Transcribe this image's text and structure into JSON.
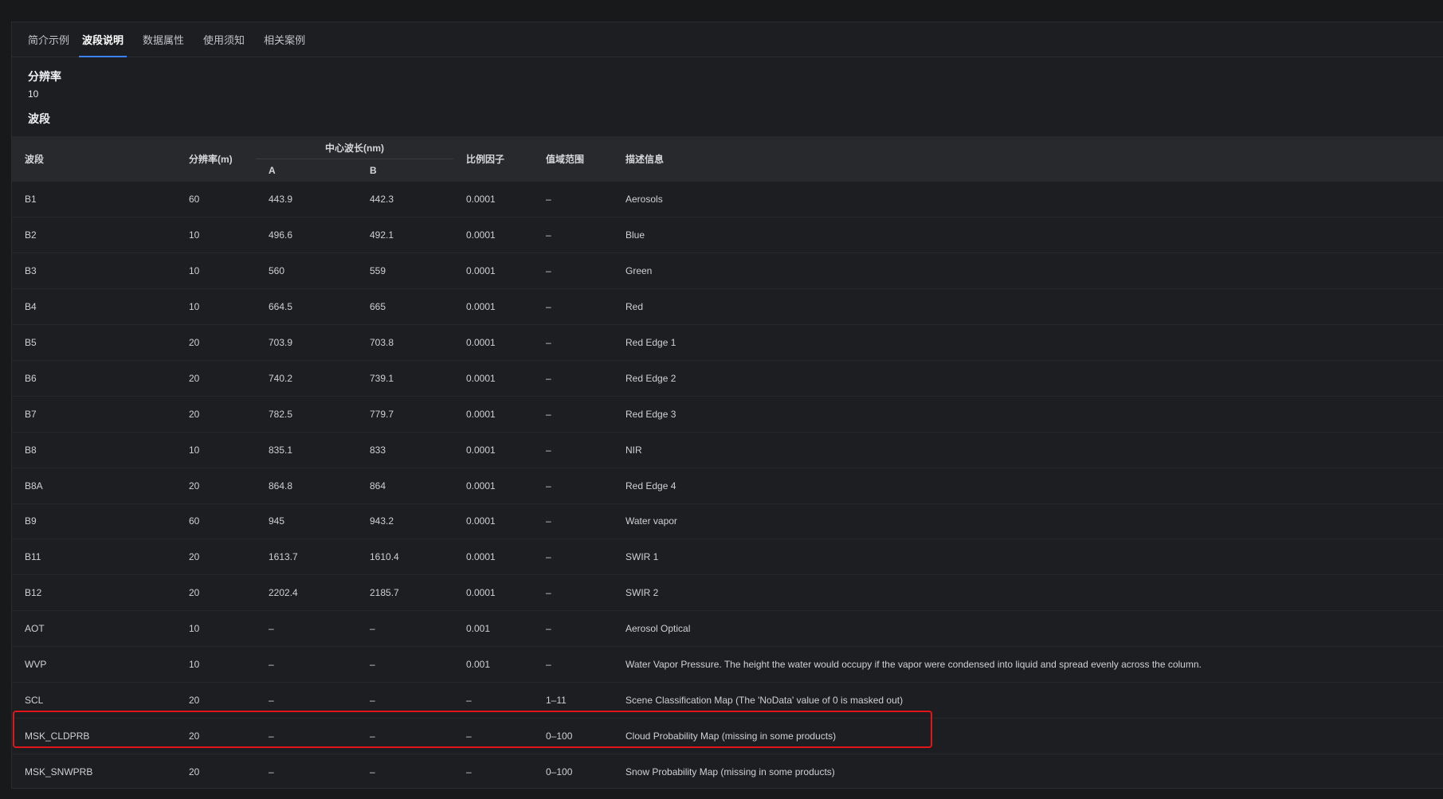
{
  "tabs": [
    {
      "label": "简介示例",
      "active": false
    },
    {
      "label": "波段说明",
      "active": true
    },
    {
      "label": "数据属性",
      "active": false
    },
    {
      "label": "使用须知",
      "active": false
    },
    {
      "label": "相关案例",
      "active": false
    }
  ],
  "resolution": {
    "title": "分辨率",
    "value": "10"
  },
  "bands_title": "波段",
  "table": {
    "headers": {
      "band": "波段",
      "resolution": "分辨率(m)",
      "center_wavelength": "中心波长(nm)",
      "a": "A",
      "b": "B",
      "scale": "比例因子",
      "range": "值域范围",
      "description": "描述信息"
    },
    "rows": [
      [
        "B1",
        "60",
        "443.9",
        "442.3",
        "0.0001",
        "–",
        "Aerosols"
      ],
      [
        "B2",
        "10",
        "496.6",
        "492.1",
        "0.0001",
        "–",
        "Blue"
      ],
      [
        "B3",
        "10",
        "560",
        "559",
        "0.0001",
        "–",
        "Green"
      ],
      [
        "B4",
        "10",
        "664.5",
        "665",
        "0.0001",
        "–",
        "Red"
      ],
      [
        "B5",
        "20",
        "703.9",
        "703.8",
        "0.0001",
        "–",
        "Red Edge 1"
      ],
      [
        "B6",
        "20",
        "740.2",
        "739.1",
        "0.0001",
        "–",
        "Red Edge 2"
      ],
      [
        "B7",
        "20",
        "782.5",
        "779.7",
        "0.0001",
        "–",
        "Red Edge 3"
      ],
      [
        "B8",
        "10",
        "835.1",
        "833",
        "0.0001",
        "–",
        "NIR"
      ],
      [
        "B8A",
        "20",
        "864.8",
        "864",
        "0.0001",
        "–",
        "Red Edge 4"
      ],
      [
        "B9",
        "60",
        "945",
        "943.2",
        "0.0001",
        "–",
        "Water vapor"
      ],
      [
        "B11",
        "20",
        "1613.7",
        "1610.4",
        "0.0001",
        "–",
        "SWIR 1"
      ],
      [
        "B12",
        "20",
        "2202.4",
        "2185.7",
        "0.0001",
        "–",
        "SWIR 2"
      ],
      [
        "AOT",
        "10",
        "–",
        "–",
        "0.001",
        "–",
        "Aerosol Optical"
      ],
      [
        "WVP",
        "10",
        "–",
        "–",
        "0.001",
        "–",
        "Water Vapor Pressure. The height the water would occupy if the vapor were condensed into liquid and spread evenly across the column."
      ],
      [
        "SCL",
        "20",
        "–",
        "–",
        "–",
        "1–11",
        "Scene Classification Map (The 'NoData' value of 0 is masked out)"
      ],
      [
        "MSK_CLDPRB",
        "20",
        "–",
        "–",
        "–",
        "0–100",
        "Cloud Probability Map (missing in some products)"
      ],
      [
        "MSK_SNWPRB",
        "20",
        "–",
        "–",
        "–",
        "0–100",
        "Snow Probability Map (missing in some products)"
      ]
    ],
    "highlighted_row": "MSK_CLDPRB"
  },
  "colors": {
    "background": "#18191b",
    "panel": "#1d1e21",
    "header": "#27292d",
    "accent": "#3b82f6",
    "highlight": "#e0161b"
  }
}
